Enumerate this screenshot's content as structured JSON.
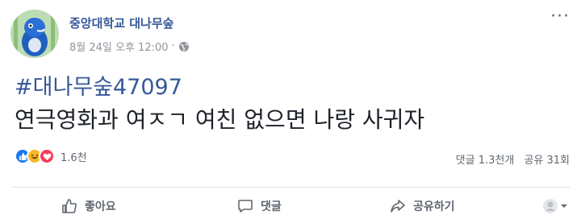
{
  "post": {
    "page_name": "중앙대학교 대나무숲",
    "timestamp": "8월 24일 오후 12:00",
    "separator": "·",
    "hashtag": "#대나무숲47097",
    "text": "연극영화과 여ㅈㄱ 여친 없으면 나랑 사귀자",
    "more_label": "···"
  },
  "reactions": {
    "types": [
      "like-icon",
      "haha-icon",
      "love-icon"
    ],
    "count": "1.6천",
    "colors": {
      "like": "#1877f2",
      "haha": "#f7b928",
      "love": "#f33e58"
    }
  },
  "stats": {
    "comments": "댓글 1.3천개",
    "shares": "공유 31회"
  },
  "actions": {
    "like": "좋아요",
    "comment": "댓글",
    "share": "공유하기"
  },
  "colors": {
    "link": "#365899",
    "meta": "#90949c",
    "divider": "#dadde1"
  }
}
